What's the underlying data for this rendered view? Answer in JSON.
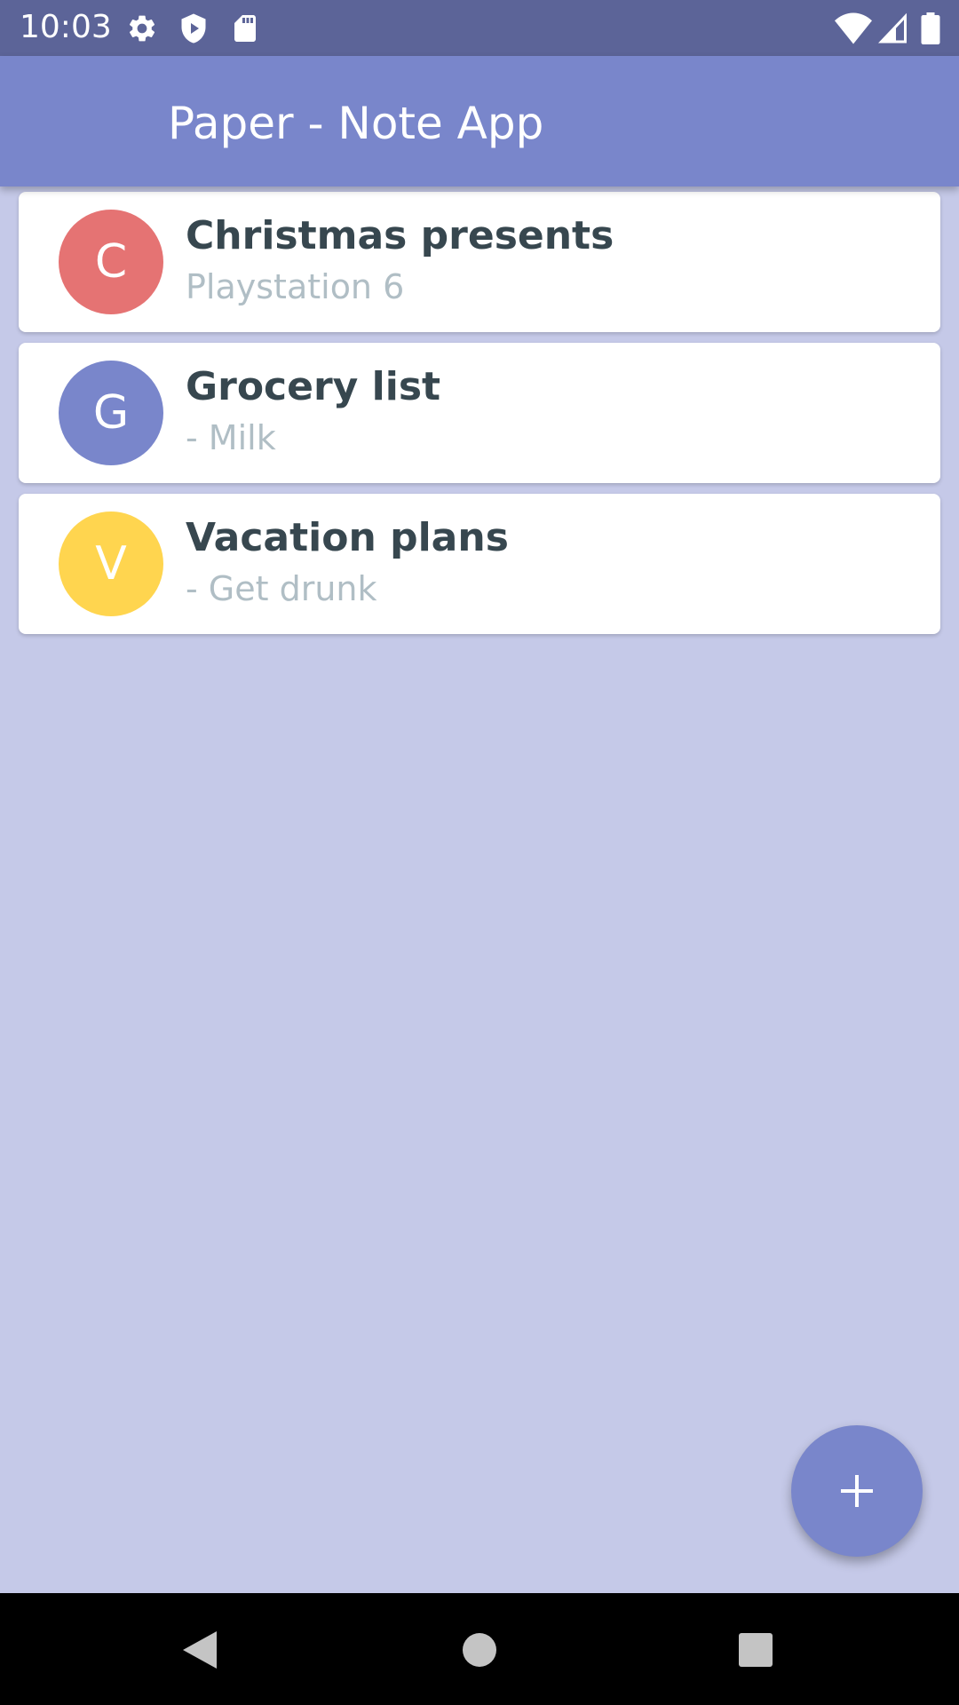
{
  "status_bar": {
    "time": "10:03",
    "left_icons": [
      "settings-icon",
      "shield-play-icon",
      "sd-card-icon"
    ],
    "right_icons": [
      "wifi-icon",
      "signal-icon",
      "battery-icon"
    ]
  },
  "app_bar": {
    "title": "Paper - Note App"
  },
  "notes": [
    {
      "initial": "C",
      "title": "Christmas presents",
      "preview": "Playstation 6",
      "color": "#e57373"
    },
    {
      "initial": "G",
      "title": "Grocery list",
      "preview": "- Milk",
      "color": "#7986cb"
    },
    {
      "initial": "V",
      "title": "Vacation plans",
      "preview": "- Get drunk",
      "color": "#ffd54f"
    }
  ],
  "fab": {
    "icon": "plus-icon"
  },
  "navigation": {
    "buttons": [
      "back-icon",
      "home-icon",
      "recents-icon"
    ]
  },
  "colors": {
    "status_bar": "#5c6498",
    "primary": "#7986cb",
    "background": "#c5c9e8"
  }
}
